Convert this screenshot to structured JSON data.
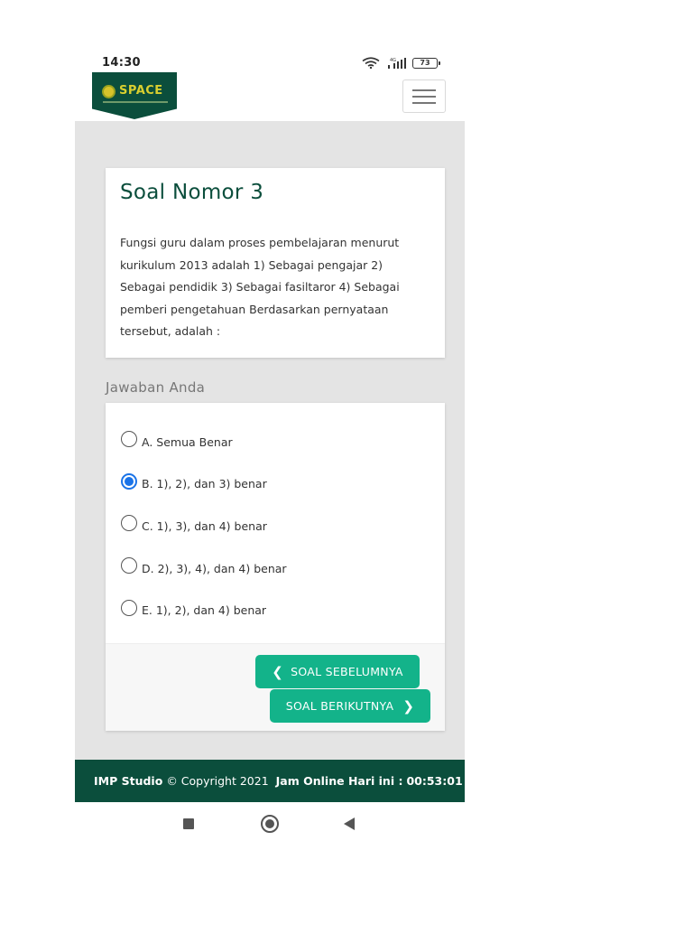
{
  "status_bar": {
    "time": "14:30",
    "network_label": "4G",
    "battery_level": "73",
    "icons": [
      "wifi-icon",
      "signal-icon",
      "battery-icon"
    ]
  },
  "header": {
    "logo_text": "SPACE",
    "menu_icon": "hamburger-menu-icon"
  },
  "question": {
    "title": "Soal Nomor 3",
    "text": "Fungsi guru dalam proses pembelajaran menurut kurikulum 2013 adalah 1) Sebagai pengajar 2) Sebagai pendidik 3) Sebagai fasiltaror 4) Sebagai pemberi pengetahuan Berdasarkan pernyataan tersebut, adalah :"
  },
  "answers": {
    "heading": "Jawaban Anda",
    "selected_index": 1,
    "options": [
      {
        "label": "A. Semua Benar",
        "checked": false
      },
      {
        "label": "B. 1), 2), dan 3) benar",
        "checked": true
      },
      {
        "label": "C. 1), 3), dan 4) benar",
        "checked": false
      },
      {
        "label": "D. 2), 3), 4), dan 4) benar",
        "checked": false
      },
      {
        "label": "E. 1), 2), dan 4) benar",
        "checked": false
      }
    ]
  },
  "navigation": {
    "prev_label": "SOAL SEBELUMNYA",
    "next_label": "SOAL BERIKUTNYA",
    "prev_icon": "chevron-left-icon",
    "next_icon": "chevron-right-icon"
  },
  "footer": {
    "studio": "IMP Studio",
    "copyright": "© Copyright 2021",
    "clock_label": "Jam Online Hari ini :",
    "clock_value": "00:53:01"
  },
  "colors": {
    "brand_dark": "#0b4e3c",
    "accent": "#13b38a",
    "radio_selected": "#1a73e8",
    "background": "#e4e4e4"
  }
}
